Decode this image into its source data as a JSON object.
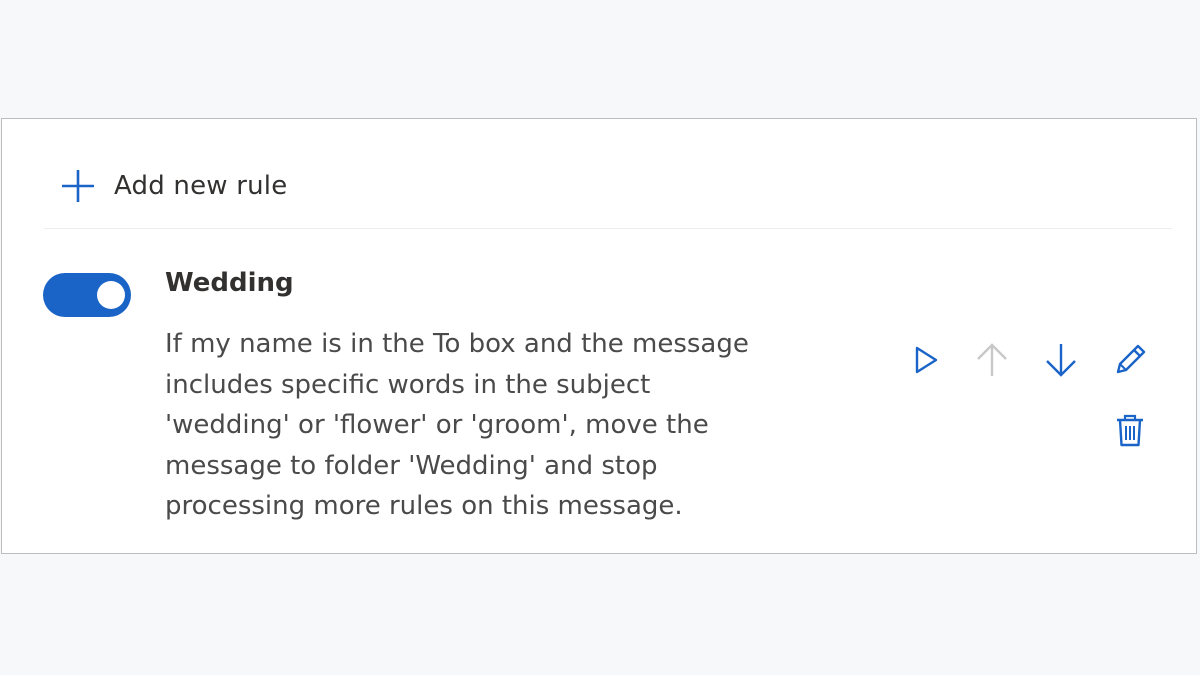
{
  "add_rule": {
    "label": "Add new rule",
    "icon": "plus-icon"
  },
  "rule": {
    "enabled": true,
    "name": "Wedding",
    "description_lines": [
      "If my name is in the To box and the message",
      "includes specific words in the subject",
      "'wedding' or 'flower' or 'groom', move the",
      "message to folder 'Wedding' and stop",
      "processing more rules on this message."
    ],
    "actions": {
      "run": "play-icon",
      "move_up": "arrow-up-icon",
      "move_down": "arrow-down-icon",
      "edit": "pencil-icon",
      "delete": "trash-icon"
    }
  },
  "colors": {
    "accent": "#1a64c8",
    "disabled": "#c8c8c8",
    "text": "#323130"
  }
}
